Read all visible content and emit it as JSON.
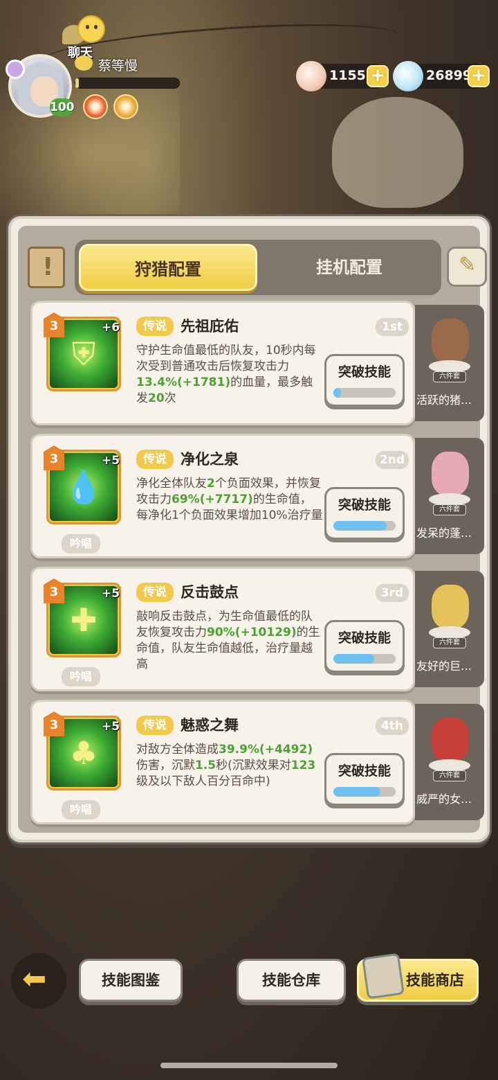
{
  "header": {
    "chat_label": "聊天",
    "player_name": "蔡等慢",
    "level": "100",
    "exp_progress": 0.03
  },
  "currencies": [
    {
      "icon": "shell-icon",
      "value": "1155"
    },
    {
      "icon": "pearl-icon",
      "value": "26899"
    }
  ],
  "tabs": {
    "active": "狩猎配置",
    "inactive": "挂机配置"
  },
  "skills": [
    {
      "level": "3",
      "plus": "+6",
      "rarity": "传说",
      "name": "先祖庇佑",
      "rank": "1st",
      "chant": "",
      "desc": [
        {
          "t": "守护生命值最低的队友，10秒内每次受到普通攻击后恢复攻击力"
        },
        {
          "t": "13.4%",
          "g": true
        },
        {
          "t": "(+1781)",
          "g": true
        },
        {
          "t": "的血量，最多触发"
        },
        {
          "t": "20",
          "g": true
        },
        {
          "t": "次"
        }
      ],
      "button": "突破技能",
      "progress": 0.12,
      "set_name": "活跃的猪…",
      "set_tag": "六件套",
      "icon_glyph": "⛨",
      "figure_color": "#9a6a4a"
    },
    {
      "level": "3",
      "plus": "+5",
      "rarity": "传说",
      "name": "净化之泉",
      "rank": "2nd",
      "chant": "吟唱",
      "desc": [
        {
          "t": "净化全体队友"
        },
        {
          "t": "2",
          "g": true
        },
        {
          "t": "个负面效果，并恢复攻击力"
        },
        {
          "t": "69%",
          "g": true
        },
        {
          "t": "(+7717)",
          "g": true
        },
        {
          "t": "的生命值，每净化1个负面效果增加10%治疗量"
        }
      ],
      "button": "突破技能",
      "progress": 0.85,
      "set_name": "发呆的蓬…",
      "set_tag": "六件套",
      "icon_glyph": "💧",
      "figure_color": "#e8a9b6"
    },
    {
      "level": "3",
      "plus": "+5",
      "rarity": "传说",
      "name": "反击鼓点",
      "rank": "3rd",
      "chant": "吟唱",
      "desc": [
        {
          "t": "敲响反击鼓点，为生命值最低的队友恢复攻击力"
        },
        {
          "t": "90%",
          "g": true
        },
        {
          "t": "(+10129)",
          "g": true
        },
        {
          "t": "的生命值，队友生命值越低，治疗量越高"
        }
      ],
      "button": "突破技能",
      "progress": 0.65,
      "set_name": "友好的巨…",
      "set_tag": "六件套",
      "icon_glyph": "✚",
      "figure_color": "#e6c25a"
    },
    {
      "level": "3",
      "plus": "+5",
      "rarity": "传说",
      "name": "魅惑之舞",
      "rank": "4th",
      "chant": "吟唱",
      "desc": [
        {
          "t": "对敌方全体造成"
        },
        {
          "t": "39.9%",
          "g": true
        },
        {
          "t": "(+4492)",
          "g": true
        },
        {
          "t": "伤害，沉默"
        },
        {
          "t": "1.5",
          "g": true
        },
        {
          "t": "秒(沉默效果对"
        },
        {
          "t": "123",
          "g": true
        },
        {
          "t": "级及以下敌人百分百命中)"
        }
      ],
      "button": "突破技能",
      "progress": 0.75,
      "set_name": "威严的女…",
      "set_tag": "六件套",
      "icon_glyph": "♣",
      "figure_color": "#c8403a"
    }
  ],
  "bottom": {
    "btn_codex": "技能图鉴",
    "btn_storage": "技能仓库",
    "btn_shop": "技能商店"
  }
}
